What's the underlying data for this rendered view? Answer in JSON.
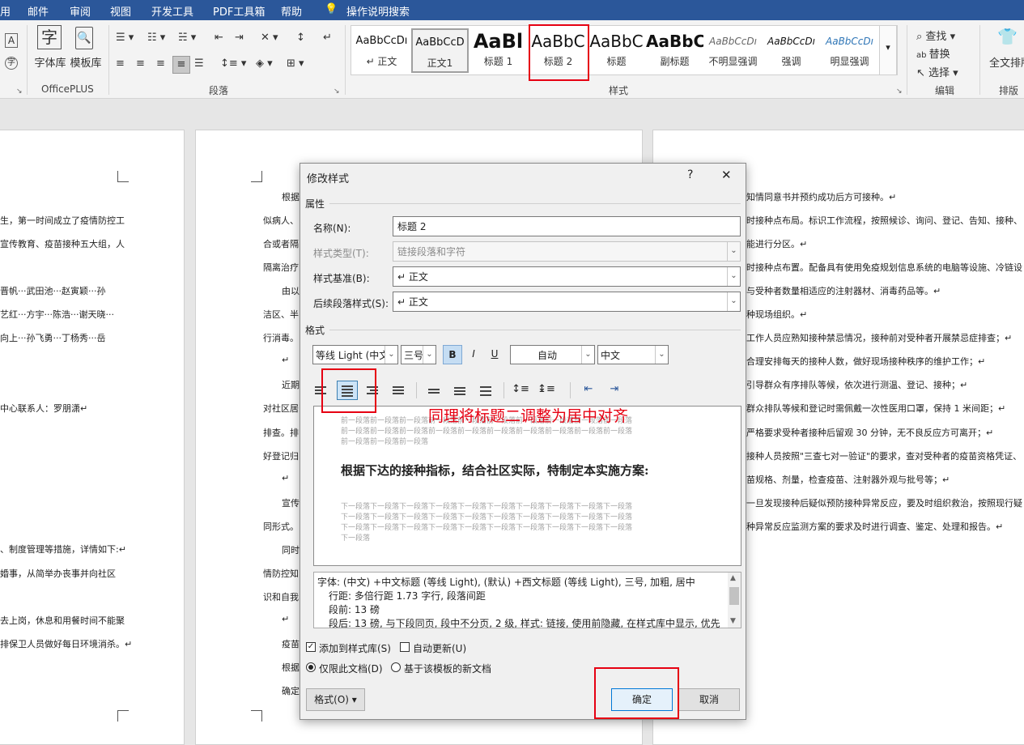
{
  "menu_tabs": [
    "用",
    "邮件",
    "审阅",
    "视图",
    "开发工具",
    "PDF工具箱",
    "帮助",
    "操作说明搜索"
  ],
  "ribbon": {
    "officeplus": {
      "btn1": "字体库",
      "btn2": "模板库",
      "label": "OfficePLUS"
    },
    "paragraph_label": "段落",
    "styles_label": "样式",
    "styles": [
      {
        "preview": "AaBbCcDı",
        "name": "↵ 正文"
      },
      {
        "preview": "AaBbCcD",
        "name": "正文1"
      },
      {
        "preview": "AaBl",
        "name": "标题 1"
      },
      {
        "preview": "AaBbC",
        "name": "标题 2"
      },
      {
        "preview": "AaBbC",
        "name": "标题"
      },
      {
        "preview": "AaBbC",
        "name": "副标题"
      },
      {
        "preview": "AaBbCcDı",
        "name": "不明显强调"
      },
      {
        "preview": "AaBbCcDı",
        "name": "强调"
      },
      {
        "preview": "AaBbCcDı",
        "name": "明显强调"
      }
    ],
    "edit": {
      "find": "查找",
      "replace": "替换",
      "select": "选择",
      "label": "编辑"
    },
    "layout": {
      "btn": "全文排版",
      "label": "排版"
    }
  },
  "left_page_lines": [
    "生，第一时间成立了疫情防控工",
    "宣传教育、疫苗接种五大组，人",
    "晋帆···武田池···赵寅颖···孙",
    "艺红···方宇···陈浩···谢天晓···",
    "向上···孙飞勇···丁杨秀···岳",
    "中心联系人：罗朋潇↵",
    "、制度管理等措施，详情如下:↵",
    "婚事，从简举办丧事并向社区",
    "去上岗，休息和用餐时间不能聚",
    "排保卫人员做好每日环境消杀。↵"
  ],
  "mid_page_lines": [
    "根据",
    "似病人、",
    "合或者隔",
    "隔离治疗",
    "由以",
    "洁区、半",
    "行消毒。",
    "↵",
    "近期",
    "对社区居",
    "排查。排",
    "好登记归",
    "↵",
    "宣传",
    "同形式。",
    "同时",
    "情防控知",
    "识和自我",
    "↵",
    "疫苗",
    "根据",
    "确定"
  ],
  "right_page_lines": [
    "知情同意书并预约成功后方可接种。↵",
    "时接种点布局。标识工作流程，按照候诊、询问、登记、告知、接种、",
    "能进行分区。↵",
    "时接种点布置。配备具有使用免疫规划信息系统的电脑等设施、冷链设",
    "与受种者数量相适应的注射器材、消毒药品等。↵",
    "种现场组织。↵",
    "工作人员应熟知接种禁忌情况，接种前对受种者开展禁忌症排查；↵",
    "合理安排每天的接种人数，做好现场接种秩序的维护工作；↵",
    "引导群众有序排队等候，依次进行测温、登记、接种；↵",
    "群众排队等候和登记时需佩戴一次性医用口罩，保持 1 米间距；↵",
    "严格要求受种者接种后留观 30 分钟，无不良反应方可离开；↵",
    "接种人员按照\"三查七对一验证\"的要求，查对受种者的疫苗资格凭证、",
    "苗规格、剂量，检查疫苗、注射器外观与批号等；↵",
    "一旦发现接种后疑似预防接种异常反应，要及时组织救治，按照现行疑",
    "种异常反应监测方案的要求及时进行调查、鉴定、处理和报告。↵"
  ],
  "dialog": {
    "title": "修改样式",
    "help": "?",
    "close": "✕",
    "section_properties": "属性",
    "name_label": "名称(N):",
    "name_value": "标题 2",
    "type_label": "样式类型(T):",
    "type_value": "链接段落和字符",
    "base_label": "样式基准(B):",
    "base_value": "↵ 正文",
    "next_label": "后续段落样式(S):",
    "next_value": "↵ 正文",
    "section_format": "格式",
    "font": "等线 Light (中文",
    "size": "三号",
    "bold": "B",
    "italic": "I",
    "underline": "U",
    "color": "自动",
    "lang": "中文",
    "annotation": "同理将标题二调整为居中对齐",
    "preview_prev": "前一段落前一段落前一段落前一段落前一段落前一段落前一段落前一段落前一段落前一段落",
    "preview_prev_last": "前一段落前一段落前一段落",
    "preview_heading": "根据下达的接种指标，结合社区实际，特制定本实施方案:",
    "preview_next": "下一段落下一段落下一段落下一段落下一段落下一段落下一段落下一段落下一段落下一段落",
    "preview_next_last": "下一段落",
    "desc_lines": [
      "字体: (中文) +中文标题 (等线 Light), (默认) +西文标题 (等线 Light), 三号, 加粗, 居中",
      "行距: 多倍行距 1.73 字行, 段落间距",
      "段前: 13 磅",
      "段后: 13 磅, 与下段同页, 段中不分页, 2 级, 样式: 链接, 使用前隐藏, 在样式库中显示, 优先"
    ],
    "add_to_gallery": "添加到样式库(S)",
    "auto_update": "自动更新(U)",
    "only_this_doc": "仅限此文档(D)",
    "new_docs_template": "基于该模板的新文档",
    "format_btn": "格式(O) ▾",
    "ok": "确定",
    "cancel": "取消"
  }
}
